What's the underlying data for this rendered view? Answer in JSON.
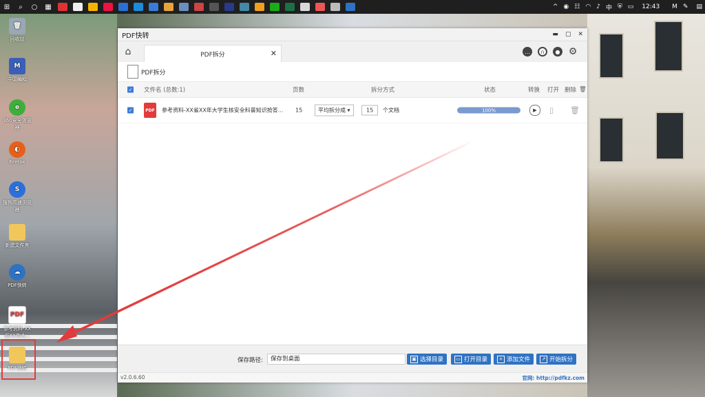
{
  "taskbar": {
    "clock": "12:43",
    "ime": "中",
    "start_glyph": "⊞",
    "search_glyph": "⌕"
  },
  "desktop": {
    "icons": [
      {
        "label": "回收站"
      },
      {
        "label": "中国编程"
      },
      {
        "label": "360安全浏览器"
      },
      {
        "label": "Firefox"
      },
      {
        "label": "搜狗高速浏览器"
      },
      {
        "label": "新建文件夹"
      },
      {
        "label": "PDF快转"
      },
      {
        "label": "参考资料-XX省XX年大..."
      },
      {
        "label": "PDF快转"
      }
    ]
  },
  "window": {
    "title": "PDF快转",
    "tab_label": "PDF拆分",
    "section_title": "PDF拆分",
    "table": {
      "headers": {
        "filename": "文件名 (总数:1)",
        "pages": "页数",
        "method": "拆分方式",
        "status": "状态",
        "convert": "转换",
        "open": "打开",
        "delete": "删除"
      },
      "rows": [
        {
          "filename": "参考资料-XX省XX年大学生核安全科普知识抢答...",
          "pages": "15",
          "method": "平均拆分成",
          "count": "15",
          "unit": "个文档",
          "progress_text": "100%"
        }
      ]
    },
    "bottom": {
      "save_path_label": "保存路径:",
      "save_path_value": "保存到桌面",
      "btn_choose_dir": "选择目录",
      "btn_open_dir": "打开目录",
      "btn_add_file": "添加文件",
      "btn_start": "开始拆分"
    },
    "status": {
      "version": "v2.0.6.60",
      "site": "官网: http://pdfkz.com"
    }
  },
  "colors": {
    "accent": "#2e72c4",
    "annotation": "#e23b3b"
  }
}
